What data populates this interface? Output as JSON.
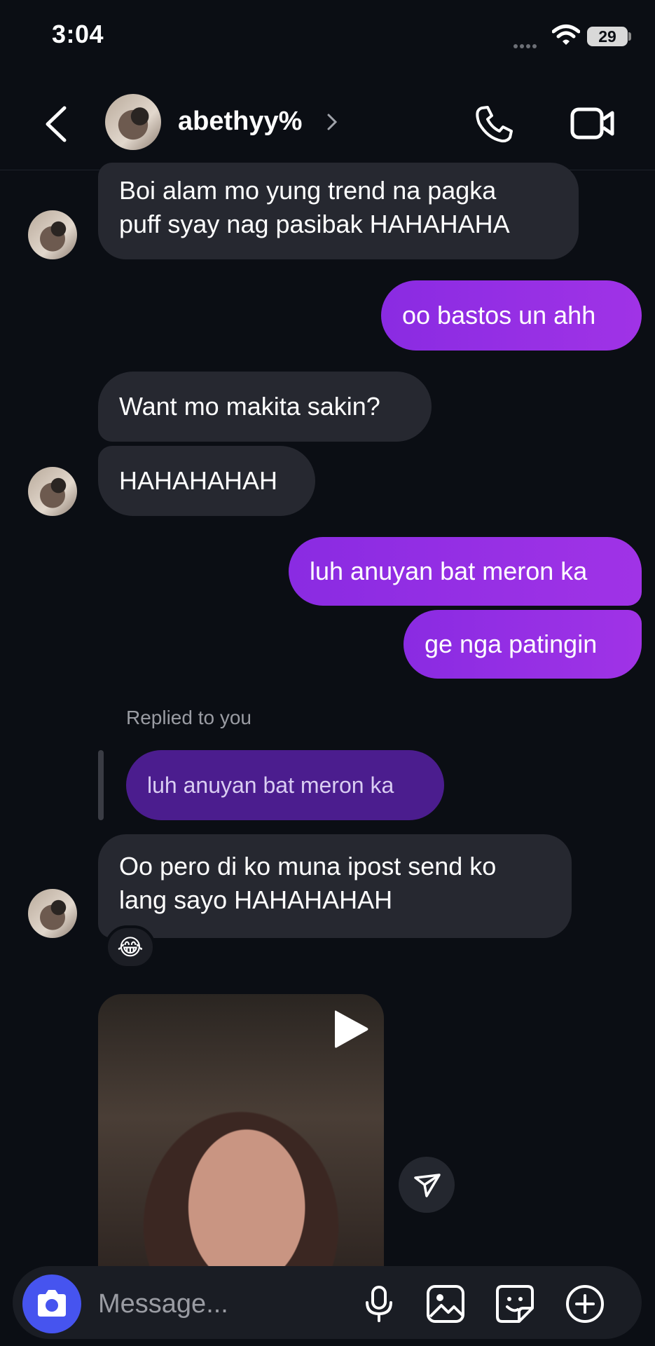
{
  "status_bar": {
    "time": "3:04",
    "battery": "29"
  },
  "header": {
    "contact_name": "abethyy%"
  },
  "messages": [
    {
      "from": "them",
      "text_line1": "Boi alam mo yung trend na pagka",
      "text_line2": "puff syay nag pasibak HAHAHAHA"
    },
    {
      "from": "me",
      "text": "oo bastos un ahh"
    },
    {
      "from": "them",
      "text": "Want mo makita sakin?"
    },
    {
      "from": "them",
      "text": "HAHAHAHAH"
    },
    {
      "from": "me",
      "text": "luh anuyan bat meron ka"
    },
    {
      "from": "me",
      "text": "ge nga patingin"
    },
    {
      "from": "them",
      "reply_label": "Replied to you",
      "quoted": "luh anuyan bat meron ka",
      "text_line1": "Oo pero di ko muna ipost send ko",
      "text_line2": "lang sayo HAHAHAHAH",
      "reaction": "😂"
    },
    {
      "from": "them",
      "type": "video"
    }
  ],
  "composer": {
    "placeholder": "Message..."
  },
  "icons": [
    "back-icon",
    "chevron-right-icon",
    "phone-icon",
    "video-call-icon",
    "camera-icon",
    "microphone-icon",
    "gallery-icon",
    "sticker-icon",
    "plus-icon",
    "play-icon",
    "share-icon"
  ],
  "colors": {
    "background": "#0b0e14",
    "sent_bubble": "#9b30e4",
    "received_bubble": "#262830",
    "camera_button": "#4654ef"
  }
}
